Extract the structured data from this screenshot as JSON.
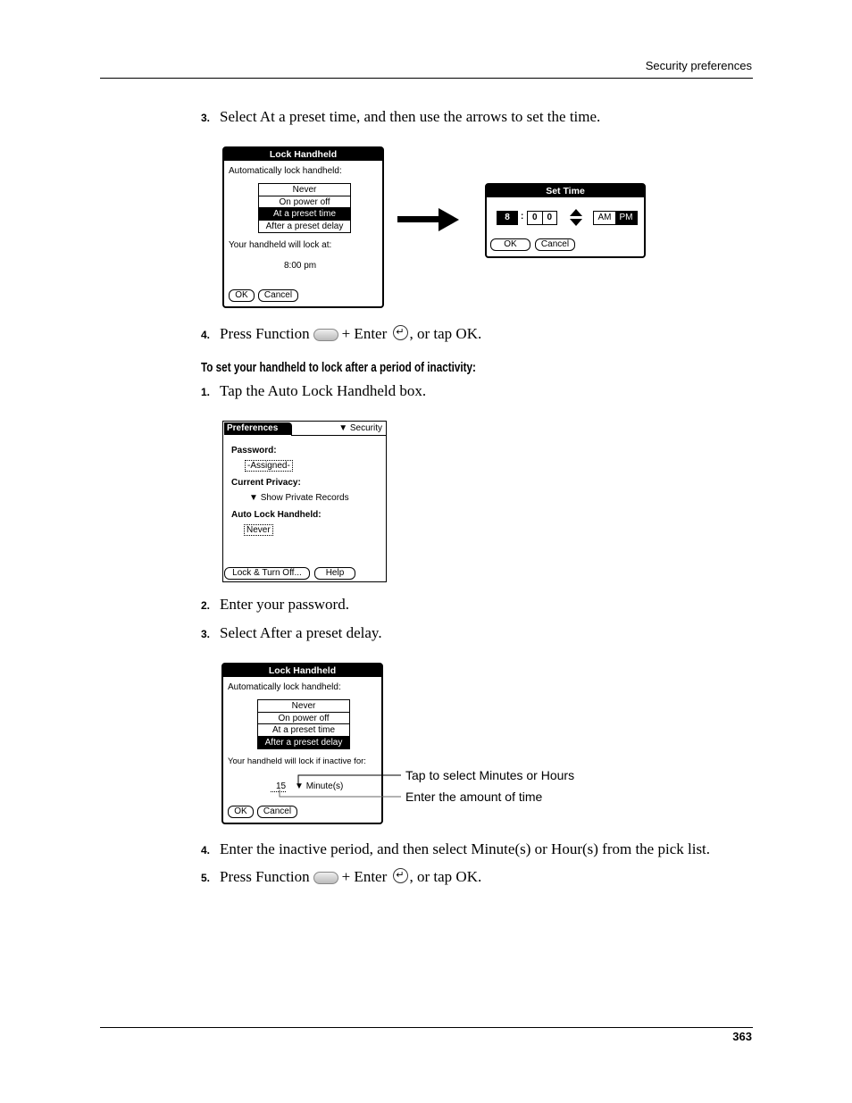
{
  "header": {
    "title": "Security preferences"
  },
  "footer": {
    "page_number": "363"
  },
  "steps_a": [
    {
      "num": "3.",
      "text": "Select At a preset time, and then use the arrows to set the time."
    },
    {
      "num": "4.",
      "pre": "Press Function",
      "mid": "+ Enter",
      "post": ", or tap OK."
    }
  ],
  "subheading": "To set your handheld to lock after a period of inactivity:",
  "steps_b": [
    {
      "num": "1.",
      "text": "Tap the Auto Lock Handheld box."
    },
    {
      "num": "2.",
      "text": "Enter your password."
    },
    {
      "num": "3.",
      "text": "Select After a preset delay."
    },
    {
      "num": "4.",
      "text": "Enter the inactive period, and then select Minute(s) or Hour(s) from the pick list."
    },
    {
      "num": "5.",
      "pre": "Press Function",
      "mid": "+ Enter",
      "post": ", or tap OK."
    }
  ],
  "lock_screen_1": {
    "title": "Lock Handheld",
    "label": "Automatically lock handheld:",
    "options": [
      "Never",
      "On power off",
      "At a preset time",
      "After a preset delay"
    ],
    "selected": 2,
    "lock_label": "Your handheld will lock at:",
    "time": "8:00 pm",
    "ok": "OK",
    "cancel": "Cancel"
  },
  "set_time": {
    "title": "Set Time",
    "hour": "8",
    "sep": ":",
    "min1": "0",
    "min2": "0",
    "am": "AM",
    "pm": "PM",
    "selected_period": "PM",
    "ok": "OK",
    "cancel": "Cancel"
  },
  "prefs": {
    "title": "Preferences",
    "category": "Security",
    "password_label": "Password:",
    "password_value": "-Assigned-",
    "privacy_label": "Current Privacy:",
    "privacy_value": "Show Private Records",
    "autolock_label": "Auto Lock Handheld:",
    "autolock_value": "Never",
    "lock_btn": "Lock & Turn Off...",
    "help_btn": "Help"
  },
  "lock_screen_2": {
    "title": "Lock Handheld",
    "label": "Automatically lock handheld:",
    "options": [
      "Never",
      "On power off",
      "At a preset time",
      "After a preset delay"
    ],
    "selected": 3,
    "inactive_label": "Your handheld will lock if inactive for:",
    "amount": "15",
    "unit": "Minute(s)",
    "ok": "OK",
    "cancel": "Cancel"
  },
  "callouts": {
    "unit": "Tap to select Minutes or Hours",
    "amount": "Enter the amount of time"
  },
  "icons": {
    "function_key": "function-key-icon",
    "enter_key": "enter-key-icon",
    "arrow": "arrow-right-icon"
  }
}
